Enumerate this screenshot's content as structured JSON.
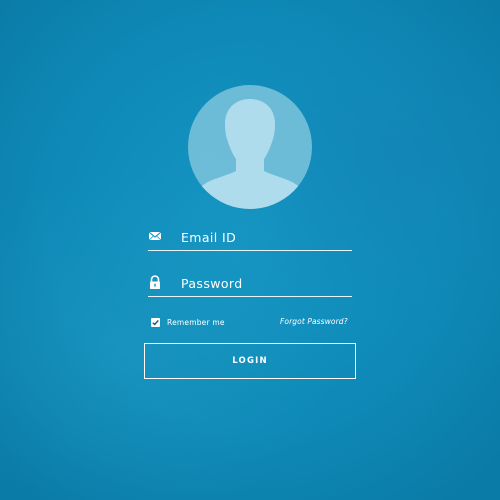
{
  "login_form": {
    "avatar_icon": "user-silhouette-icon",
    "email": {
      "icon": "envelope-icon",
      "placeholder": "Email ID",
      "value": ""
    },
    "password": {
      "icon": "padlock-icon",
      "placeholder": "Password",
      "value": ""
    },
    "remember": {
      "label": "Remember me",
      "checked": true
    },
    "forgot_password_label": "Forgot Password?",
    "login_button_label": "LOGIN"
  },
  "colors": {
    "background": "#1190bf",
    "avatar_circle": "#7ec4dc",
    "avatar_silhouette": "#aedced",
    "foreground": "#ffffff",
    "checkmark": "#0f5a7a"
  }
}
